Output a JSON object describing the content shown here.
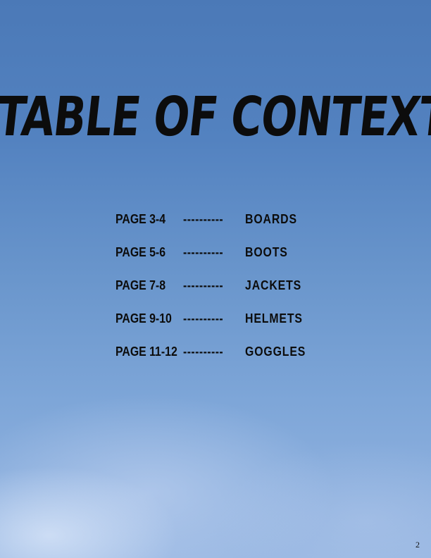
{
  "title": "TABLE OF CONTEXT",
  "contents": [
    {
      "pages": "PAGE 3-4",
      "leader": "----------",
      "section": "BOARDS"
    },
    {
      "pages": "PAGE 5-6",
      "leader": "----------",
      "section": "BOOTS"
    },
    {
      "pages": "PAGE 7-8",
      "leader": "----------",
      "section": "JACKETS"
    },
    {
      "pages": "PAGE 9-10",
      "leader": "----------",
      "section": "HELMETS"
    },
    {
      "pages": "PAGE 11-12",
      "leader": "----------",
      "section": "GOGGLES"
    }
  ],
  "page_number": "2"
}
